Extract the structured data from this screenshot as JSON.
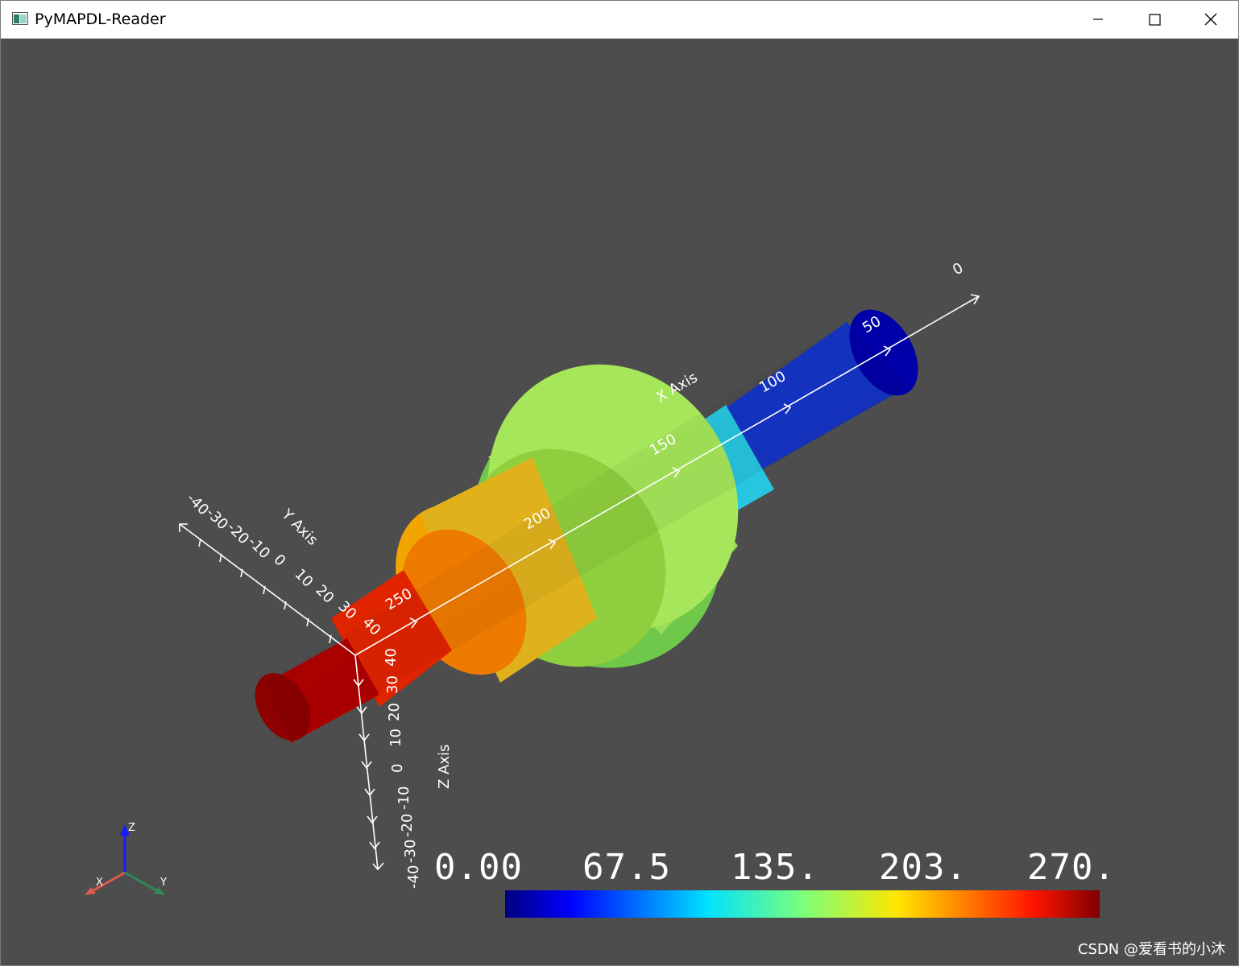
{
  "window": {
    "title": "PyMAPDL-Reader",
    "controls": {
      "minimize": "minimize-icon",
      "maximize": "maximize-icon",
      "close": "close-icon"
    }
  },
  "plot": {
    "background_color": "#4d4d4d",
    "x_axis": {
      "title": "X Axis",
      "ticks": [
        "0",
        "50",
        "100",
        "150",
        "200",
        "250"
      ]
    },
    "y_axis": {
      "title": "Y Axis",
      "ticks": [
        "-40",
        "-30",
        "-20",
        "-10",
        "0",
        "10",
        "20",
        "30",
        "40"
      ]
    },
    "z_axis": {
      "title": "Z Axis",
      "ticks": [
        "40",
        "30",
        "20",
        "10",
        "0",
        "-10",
        "-20",
        "-30",
        "-40"
      ]
    },
    "orientation_widget": {
      "z": "Z",
      "x": "X",
      "y": "Y"
    },
    "colorbar": {
      "labels": [
        "0.00",
        "67.5",
        "135.",
        "203.",
        "270."
      ],
      "colormap": "jet"
    }
  },
  "watermark": "CSDN @爱看书的小沐"
}
